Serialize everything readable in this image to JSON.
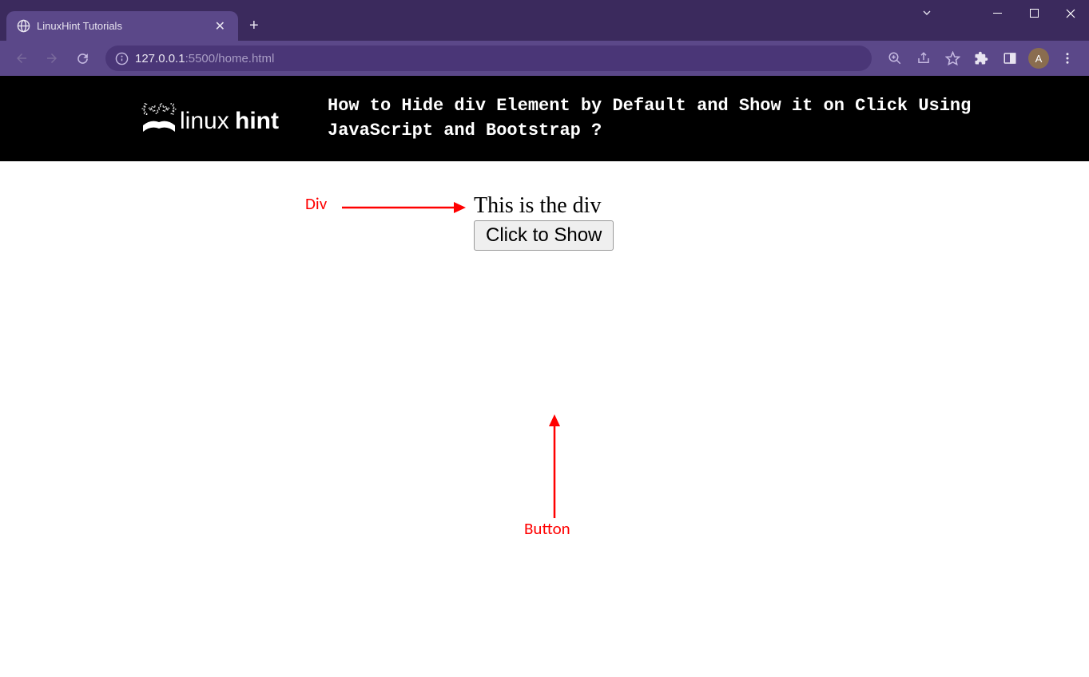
{
  "browser": {
    "tab_title": "LinuxHint Tutorials",
    "url_host": "127.0.0.1",
    "url_port": ":5500",
    "url_path": "/home.html",
    "avatar_letter": "A"
  },
  "page": {
    "logo_text": "linuxhint",
    "header_title": "How to Hide div Element by Default and Show it on Click Using JavaScript and Bootstrap ?",
    "div_text": "This is the div",
    "button_label": "Click to Show"
  },
  "annotations": {
    "div_label": "Div",
    "button_label": "Button"
  }
}
